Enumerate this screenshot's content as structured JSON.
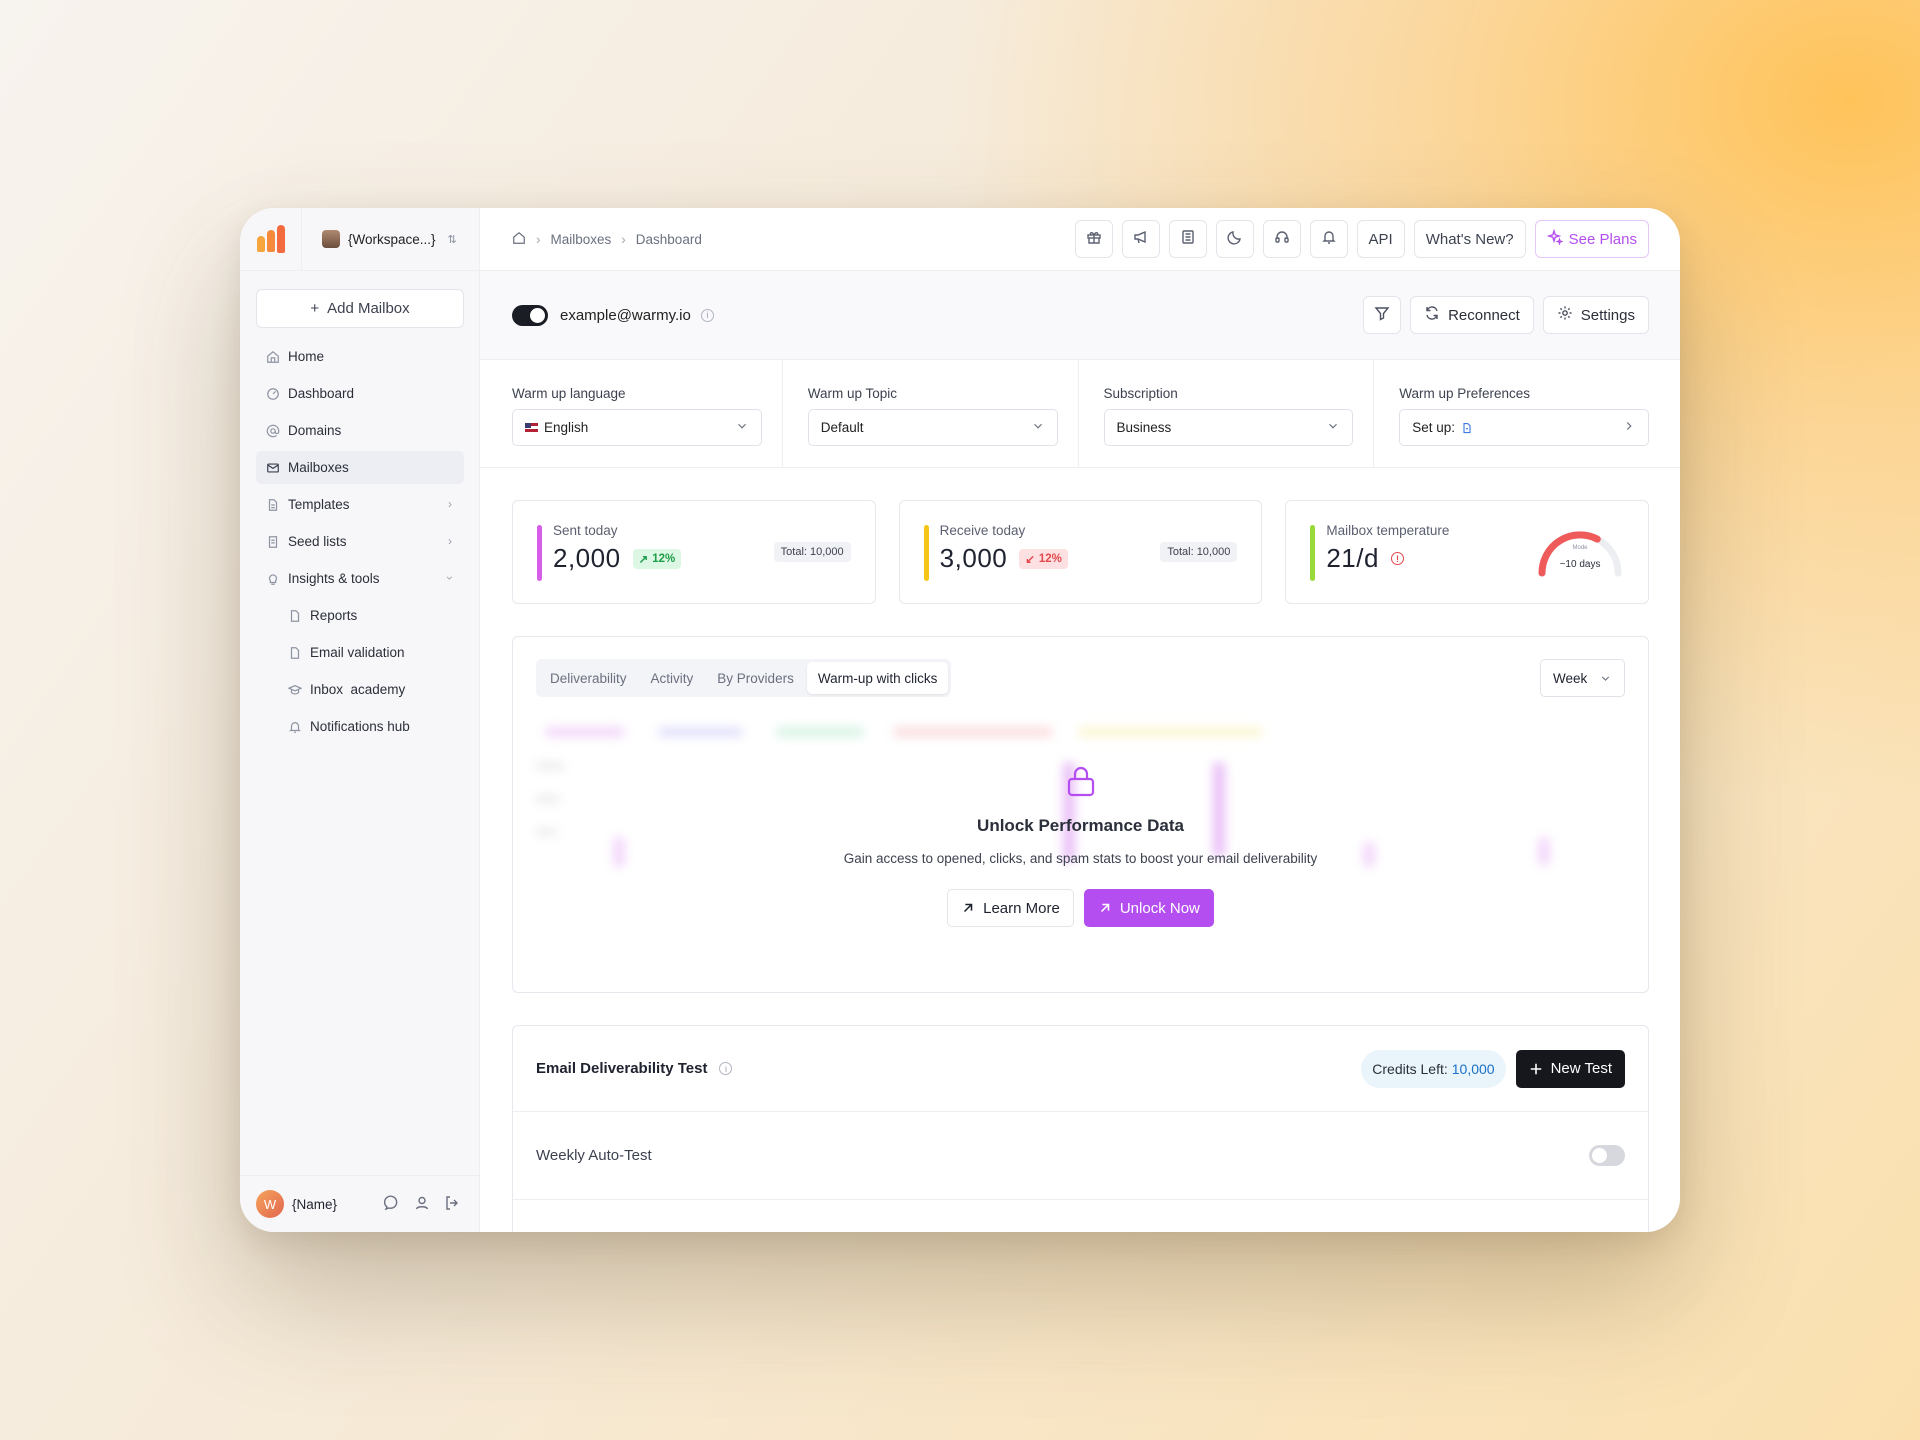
{
  "app": {
    "brand_colors": [
      "#f7a63d",
      "#f36a3f",
      "#b44ef0"
    ]
  },
  "sidebar": {
    "workspace": "{Workspace...}",
    "add_mailbox": "Add Mailbox",
    "items": [
      {
        "label": "Home",
        "icon": "home-icon"
      },
      {
        "label": "Dashboard",
        "icon": "dashboard-icon"
      },
      {
        "label": "Domains",
        "icon": "at-icon"
      },
      {
        "label": "Mailboxes",
        "icon": "mail-icon",
        "active": true
      },
      {
        "label": "Templates",
        "icon": "file-icon"
      },
      {
        "label": "Seed lists",
        "icon": "list-icon"
      },
      {
        "label": "Insights & tools",
        "icon": "bulb-icon",
        "expanded": true
      }
    ],
    "sub_items": [
      {
        "label": "Reports",
        "icon": "doc-icon"
      },
      {
        "label": "Email validation",
        "icon": "doc-icon"
      },
      {
        "label": "Inbox  academy",
        "icon": "cap-icon"
      },
      {
        "label": "Notifications hub",
        "icon": "bell-icon"
      }
    ],
    "user_initial": "W",
    "user_name": "{Name}"
  },
  "topbar": {
    "breadcrumbs": [
      "Mailboxes",
      "Dashboard"
    ],
    "api_label": "API",
    "whats_new": "What's New?",
    "see_plans": "See Plans"
  },
  "mailbox": {
    "email": "example@warmy.io",
    "enabled": true,
    "reconnect": "Reconnect",
    "settings": "Settings"
  },
  "settings": {
    "language_label": "Warm up language",
    "language_value": "English",
    "topic_label": "Warm up Topic",
    "topic_value": "Default",
    "subscription_label": "Subscription",
    "subscription_value": "Business",
    "prefs_label": "Warm up Preferences",
    "prefs_value": "Set up:"
  },
  "stats": {
    "sent": {
      "label": "Sent today",
      "value": "2,000",
      "change": "12%",
      "direction": "up",
      "total": "Total: 10,000",
      "color": "#d65ee8"
    },
    "received": {
      "label": "Receive today",
      "value": "3,000",
      "change": "12%",
      "direction": "down",
      "total": "Total: 10,000",
      "color": "#f5c518"
    },
    "temperature": {
      "label": "Mailbox temperature",
      "value": "21/d",
      "gauge_small": "Mode",
      "gauge_text": "~10 days",
      "color": "#9ad93a",
      "gauge_fraction": 0.65
    }
  },
  "performance": {
    "tabs": [
      "Deliverability",
      "Activity",
      "By Providers",
      "Warm-up with clicks"
    ],
    "active_tab": 3,
    "period": "Week",
    "title": "Unlock Performance Data",
    "subtitle": "Gain access to opened, clicks, and spam stats to boost your email deliverability",
    "learn_more": "Learn More",
    "unlock_now": "Unlock Now"
  },
  "deliverability_test": {
    "title": "Email Deliverability Test",
    "credits_label": "Credits Left:",
    "credits_value": "10,000",
    "new_test": "New Test",
    "auto_test_label": "Weekly Auto-Test",
    "auto_test_enabled": false
  }
}
